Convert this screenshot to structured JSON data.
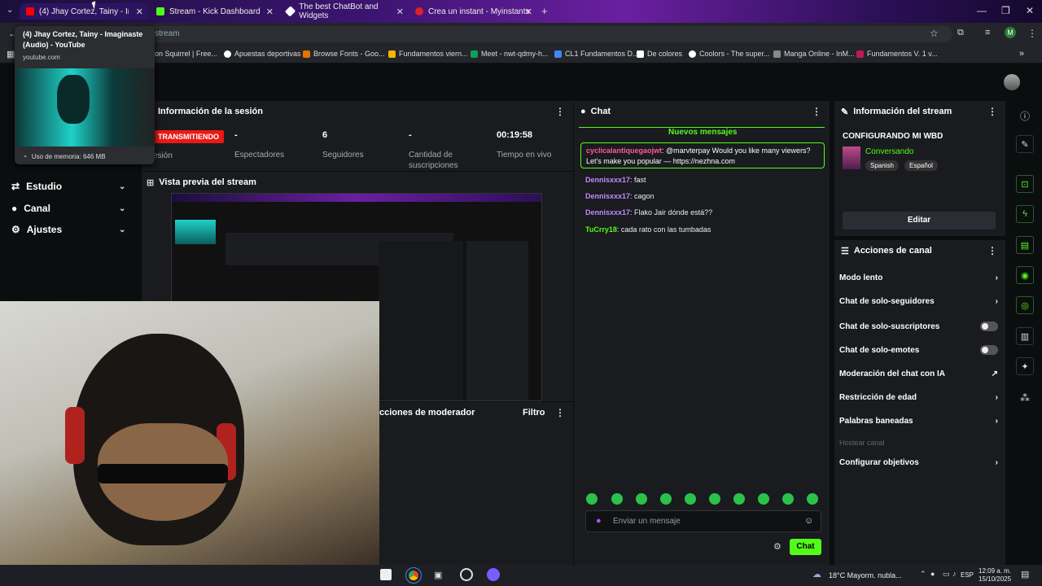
{
  "browser": {
    "tabs": [
      {
        "title": "(4) Jhay Cortez, Tainy - Imaginaste",
        "color": "#ff0000"
      },
      {
        "title": "Stream - Kick Dashboard",
        "color": "#53fc18"
      },
      {
        "title": "The best ChatBot and Widgets",
        "color": "#ffffff"
      },
      {
        "title": "Crea un instant - Myinstants",
        "color": "#e0202a"
      }
    ],
    "address": "stream",
    "bookmarks": [
      "on Squirrel | Free...",
      "Apuestas deportivas",
      "Browse Fonts - Goo...",
      "Fundamentos viern...",
      "Meet - nwt-qdmy-h...",
      "CL1 Fundamentos D...",
      "De colores",
      "Coolors - The super...",
      "Manga Online - InM...",
      "Fundamentos V. 1 v..."
    ],
    "profile_initial": "M"
  },
  "tooltip": {
    "title": "(4) Jhay Cortez, Tainy - Imaginaste (Audio) - YouTube",
    "domain": "youtube.com",
    "memory": "Uso de memoria: 646 MB"
  },
  "session": {
    "title": "Información de la sesión",
    "live_badge": "TRANSMITIENDO",
    "session_label": "esión",
    "stats": [
      {
        "value": "-",
        "label": "Espectadores"
      },
      {
        "value": "6",
        "label": "Seguidores"
      },
      {
        "value": "-",
        "label": "Cantidad de suscripciones"
      },
      {
        "value": "00:19:58",
        "label": "Tiempo en vivo"
      }
    ]
  },
  "sidebar": {
    "items": [
      {
        "label": "Estudio",
        "icon": "studio-icon"
      },
      {
        "label": "Canal",
        "icon": "channel-icon"
      },
      {
        "label": "Ajustes",
        "icon": "gear-icon"
      }
    ]
  },
  "preview": {
    "title": "Vista previa del stream"
  },
  "moderator": {
    "title": "cciones de moderador",
    "filter": "Filtro"
  },
  "chat": {
    "title": "Chat",
    "new_messages": "Nuevos mensajes",
    "highlight": {
      "user": "cyclicalantiquegaojwt",
      "text": ": @marvterpay Would you like many viewers? Let's make you popular — https://nezhna.com"
    },
    "messages": [
      {
        "user": "Dennisxxx17",
        "text": ": fast",
        "color": "#c38bff"
      },
      {
        "user": "Dennisxxx17",
        "text": ": cagon",
        "color": "#c38bff"
      },
      {
        "user": "Dennisxxx17",
        "text": ": Flako Jair dónde está??",
        "color": "#c38bff"
      },
      {
        "user": "TuCrry18",
        "text": ": cada rato con las tumbadas",
        "color": "#53fc18"
      }
    ],
    "input_placeholder": "Enviar un mensaje",
    "send_label": "Chat"
  },
  "stream_info": {
    "title": "Información del stream",
    "stream_title": "CONFIGURANDO MI WBD",
    "category": "Conversando",
    "tags": [
      "Spanish",
      "Español"
    ],
    "edit_label": "Editar"
  },
  "actions": {
    "title": "Acciones de canal",
    "items": [
      {
        "label": "Modo lento",
        "kind": "chevron"
      },
      {
        "label": "Chat de solo-seguidores",
        "kind": "chevron"
      },
      {
        "label": "Chat de solo-suscriptores",
        "kind": "toggle"
      },
      {
        "label": "Chat de solo-emotes",
        "kind": "toggle"
      },
      {
        "label": "Moderación del chat con IA",
        "kind": "external"
      },
      {
        "label": "Restricción de edad",
        "kind": "chevron"
      },
      {
        "label": "Palabras baneadas",
        "kind": "chevron"
      },
      {
        "label": "Hostear canal",
        "kind": "disabled"
      },
      {
        "label": "Configurar objetivos",
        "kind": "chevron"
      }
    ]
  },
  "taskbar": {
    "weather": "18°C  Mayorm. nubla...",
    "lang": "ESP",
    "time": "12:09 a. m.",
    "date": "15/10/2025"
  },
  "colors": {
    "accent": "#53fc18",
    "live": "#e91916",
    "panel": "#191b1f"
  }
}
